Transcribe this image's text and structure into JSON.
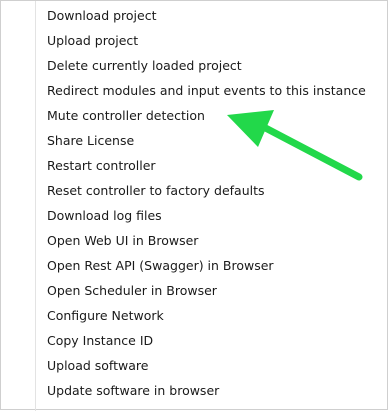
{
  "menu": {
    "items": [
      {
        "label": "Download project"
      },
      {
        "label": "Upload project"
      },
      {
        "label": "Delete currently loaded project"
      },
      {
        "label": "Redirect modules and input events to this instance"
      },
      {
        "label": "Mute controller detection"
      },
      {
        "label": "Share License"
      },
      {
        "label": "Restart controller"
      },
      {
        "label": "Reset controller to factory defaults"
      },
      {
        "label": "Download log files"
      },
      {
        "label": "Open Web UI in Browser"
      },
      {
        "label": "Open Rest API (Swagger) in Browser"
      },
      {
        "label": "Open Scheduler in Browser"
      },
      {
        "label": "Configure Network"
      },
      {
        "label": "Copy Instance ID"
      },
      {
        "label": "Upload software"
      },
      {
        "label": "Update software in browser"
      }
    ]
  },
  "annotation": {
    "arrow_color": "#22d84a",
    "icon": "arrow-icon"
  }
}
